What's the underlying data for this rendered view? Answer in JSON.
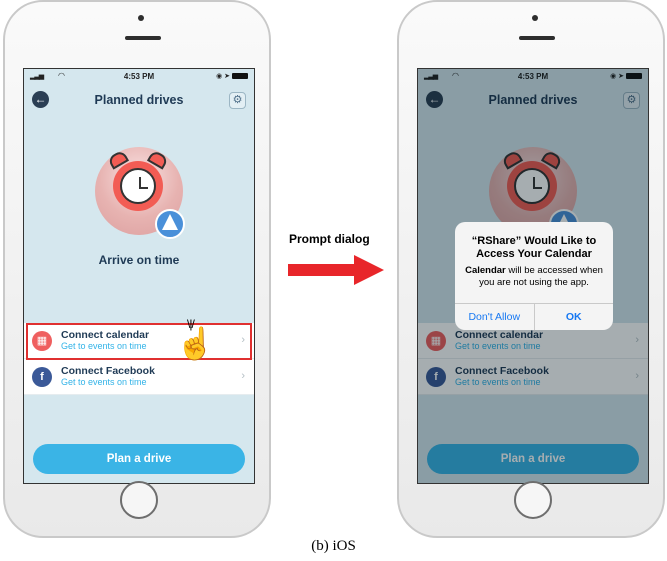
{
  "status_bar": {
    "time": "4:53 PM"
  },
  "navbar": {
    "title": "Planned drives",
    "back_icon": "arrow-left-icon",
    "settings_icon": "gear-icon"
  },
  "hero": {
    "illustration": "alarm-clock-icon",
    "label": "Arrive on time"
  },
  "list": [
    {
      "title": "Connect calendar",
      "subtitle": "Get to events on time",
      "icon": "calendar-icon"
    },
    {
      "title": "Connect Facebook",
      "subtitle": "Get to events on time",
      "icon": "facebook-icon"
    }
  ],
  "primary_button": {
    "label": "Plan a drive"
  },
  "prompt": {
    "label": "Prompt dialog"
  },
  "dialog": {
    "title": "“RShare” Would Like to Access Your Calendar",
    "message_bold": "Calendar",
    "message_rest": " will be accessed when you are not using the app.",
    "deny_label": "Don't Allow",
    "ok_label": "OK"
  },
  "caption": "(b) iOS",
  "colors": {
    "screen_bg": "#d5e7ee",
    "primary_blue": "#3ab4e6",
    "highlight_red": "#e03030",
    "arrow_red": "#e8262a"
  }
}
